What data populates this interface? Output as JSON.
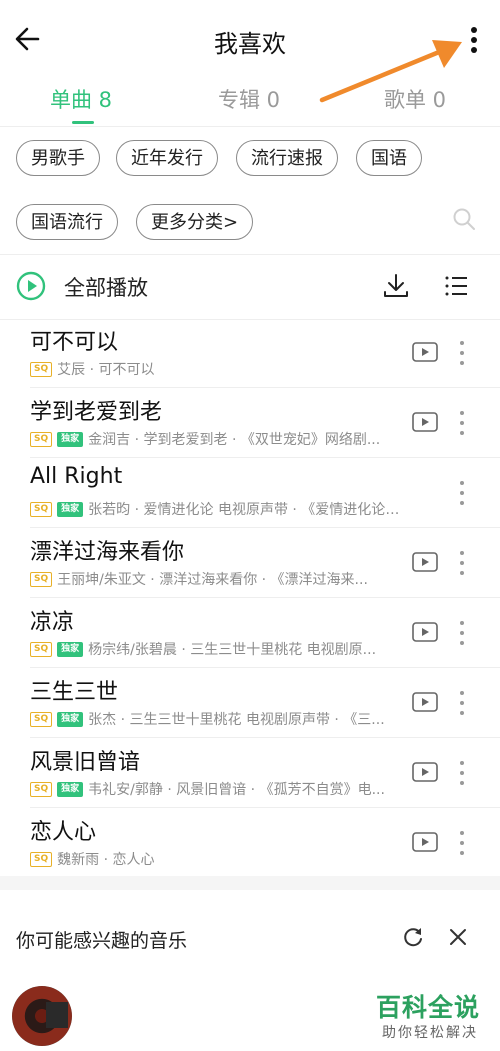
{
  "header": {
    "title": "我喜欢"
  },
  "tabs": [
    {
      "label": "单曲 8",
      "active": true
    },
    {
      "label": "专辑 0",
      "active": false
    },
    {
      "label": "歌单 0",
      "active": false
    }
  ],
  "chips": [
    "男歌手",
    "近年发行",
    "流行速报",
    "国语",
    "国语流行",
    "更多分类>"
  ],
  "play_all": {
    "label": "全部播放"
  },
  "songs": [
    {
      "title": "可不可以",
      "badges": [
        "SQ"
      ],
      "subtitle": "艾辰 · 可不可以",
      "has_video": true
    },
    {
      "title": "学到老爱到老",
      "badges": [
        "SQ",
        "独家"
      ],
      "subtitle": "金润吉 · 学到老爱到老 · 《双世宠妃》网络剧...",
      "has_video": true
    },
    {
      "title": "All Right",
      "badges": [
        "SQ",
        "独家"
      ],
      "subtitle": "张若昀 · 爱情进化论 电视原声带 · 《爱情进化论》...",
      "has_video": false
    },
    {
      "title": "漂洋过海来看你",
      "badges": [
        "SQ"
      ],
      "subtitle": "王丽坤/朱亚文 · 漂洋过海来看你 · 《漂洋过海来...",
      "has_video": true
    },
    {
      "title": "凉凉",
      "badges": [
        "SQ",
        "独家"
      ],
      "subtitle": "杨宗纬/张碧晨 · 三生三世十里桃花 电视剧原...",
      "has_video": true
    },
    {
      "title": "三生三世",
      "badges": [
        "SQ",
        "独家"
      ],
      "subtitle": "张杰 · 三生三世十里桃花 电视剧原声带 · 《三...",
      "has_video": true
    },
    {
      "title": "风景旧曾谙",
      "badges": [
        "SQ",
        "独家"
      ],
      "subtitle": "韦礼安/郭静 · 风景旧曾谙 · 《孤芳不自赏》电...",
      "has_video": true
    },
    {
      "title": "恋人心",
      "badges": [
        "SQ"
      ],
      "subtitle": "魏新雨 · 恋人心",
      "has_video": true
    }
  ],
  "recommend": {
    "title": "你可能感兴趣的音乐"
  },
  "watermark": {
    "title": "百科全说",
    "subtitle": "助你轻松解决"
  },
  "colors": {
    "accent": "#31c27c",
    "sq_badge": "#e8b128",
    "arrow": "#f08a2c"
  }
}
